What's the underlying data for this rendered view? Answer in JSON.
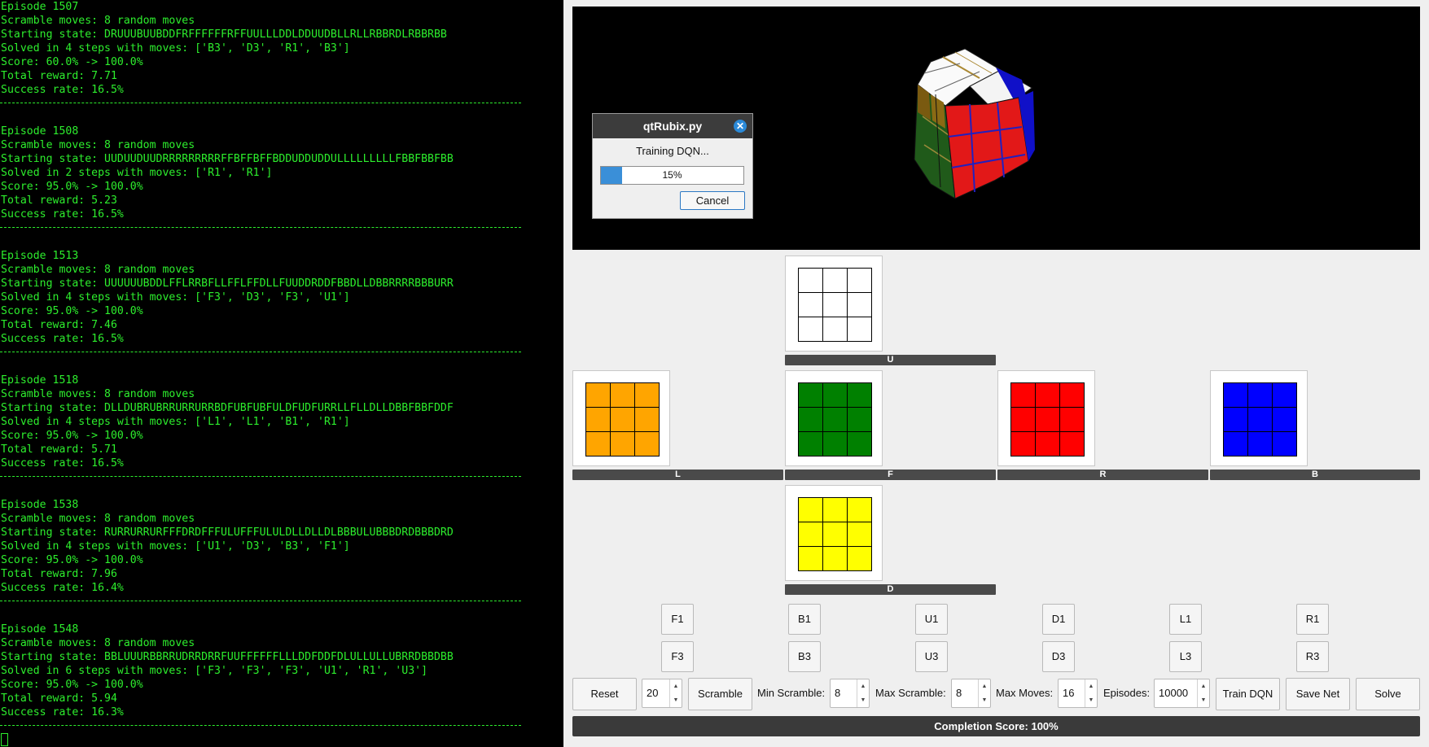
{
  "terminal": {
    "lines": [
      "Episode 1507",
      "Scramble moves: 8 random moves",
      "Starting state: DRUUUBUUBDDFRFFFFFFRFFUULLLDDLDDUUDBLLRLLRBBRDLRBBRBB",
      "Solved in 4 steps with moves: ['B3', 'D3', 'R1', 'B3']",
      "Score: 60.0% -> 100.0%",
      "Total reward: 7.71",
      "Success rate: 16.5%",
      "Episode 1508",
      "Scramble moves: 8 random moves",
      "Starting state: UUDUUDUUDRRRRRRRRRFFBFFBFFBDDUDDUDDULLLLLLLLLFBBFBBFBB",
      "Solved in 2 steps with moves: ['R1', 'R1']",
      "Score: 95.0% -> 100.0%",
      "Total reward: 5.23",
      "Success rate: 16.5%",
      "Episode 1513",
      "Scramble moves: 8 random moves",
      "Starting state: UUUUUUBDDLFFLRRBFLLFFLFFDLLFUUDDRDDFBBDLLDBBRRRRBBBURR",
      "Solved in 4 steps with moves: ['F3', 'D3', 'F3', 'U1']",
      "Score: 95.0% -> 100.0%",
      "Total reward: 7.46",
      "Success rate: 16.5%",
      "Episode 1518",
      "Scramble moves: 8 random moves",
      "Starting state: DLLDUBRUBRRURRURRBDFUBFUBFULDFUDFURRLLFLLDLLDBBFBBFDDF",
      "Solved in 4 steps with moves: ['L1', 'L1', 'B1', 'R1']",
      "Score: 95.0% -> 100.0%",
      "Total reward: 5.71",
      "Success rate: 16.5%",
      "Episode 1538",
      "Scramble moves: 8 random moves",
      "Starting state: RURRURRURFFFDRDFFFULUFFFULULDLLDLLDLBBBULUBBBDRDBBBDRD",
      "Solved in 4 steps with moves: ['U1', 'D3', 'B3', 'F1']",
      "Score: 95.0% -> 100.0%",
      "Total reward: 7.96",
      "Success rate: 16.4%",
      "Episode 1548",
      "Scramble moves: 8 random moves",
      "Starting state: BBLUUURBBRRUDRRDRRFUUFFFFFFLLLDDFDDFDLULLULLUBRRDBBDBB",
      "Solved in 6 steps with moves: ['F3', 'F3', 'F3', 'U1', 'R1', 'U3']",
      "Score: 95.0% -> 100.0%",
      "Total reward: 5.94",
      "Success rate: 16.3%"
    ]
  },
  "dialog": {
    "title": "qtRubix.py",
    "message": "Training DQN...",
    "progress": 0.15,
    "progress_text": "15%",
    "cancel_label": "Cancel"
  },
  "faces": {
    "U": {
      "label": "U",
      "color": "#ffffff"
    },
    "L": {
      "label": "L",
      "color": "#ffa500"
    },
    "F": {
      "label": "F",
      "color": "#008000"
    },
    "R": {
      "label": "R",
      "color": "#ff0000"
    },
    "B": {
      "label": "B",
      "color": "#0000ff"
    },
    "D": {
      "label": "D",
      "color": "#ffff00"
    }
  },
  "moves": {
    "row1": [
      "F1",
      "B1",
      "U1",
      "D1",
      "L1",
      "R1"
    ],
    "row2": [
      "F3",
      "B3",
      "U3",
      "D3",
      "L3",
      "R3"
    ]
  },
  "controls": {
    "reset": "Reset",
    "scramble_count": "20",
    "scramble": "Scramble",
    "min_scramble_label": "Min Scramble:",
    "min_scramble": "8",
    "max_scramble_label": "Max Scramble:",
    "max_scramble": "8",
    "max_moves_label": "Max Moves:",
    "max_moves": "16",
    "episodes_label": "Episodes:",
    "episodes": "10000",
    "train": "Train DQN",
    "save": "Save Net",
    "solve": "Solve"
  },
  "completion_score": "Completion Score: 100%"
}
